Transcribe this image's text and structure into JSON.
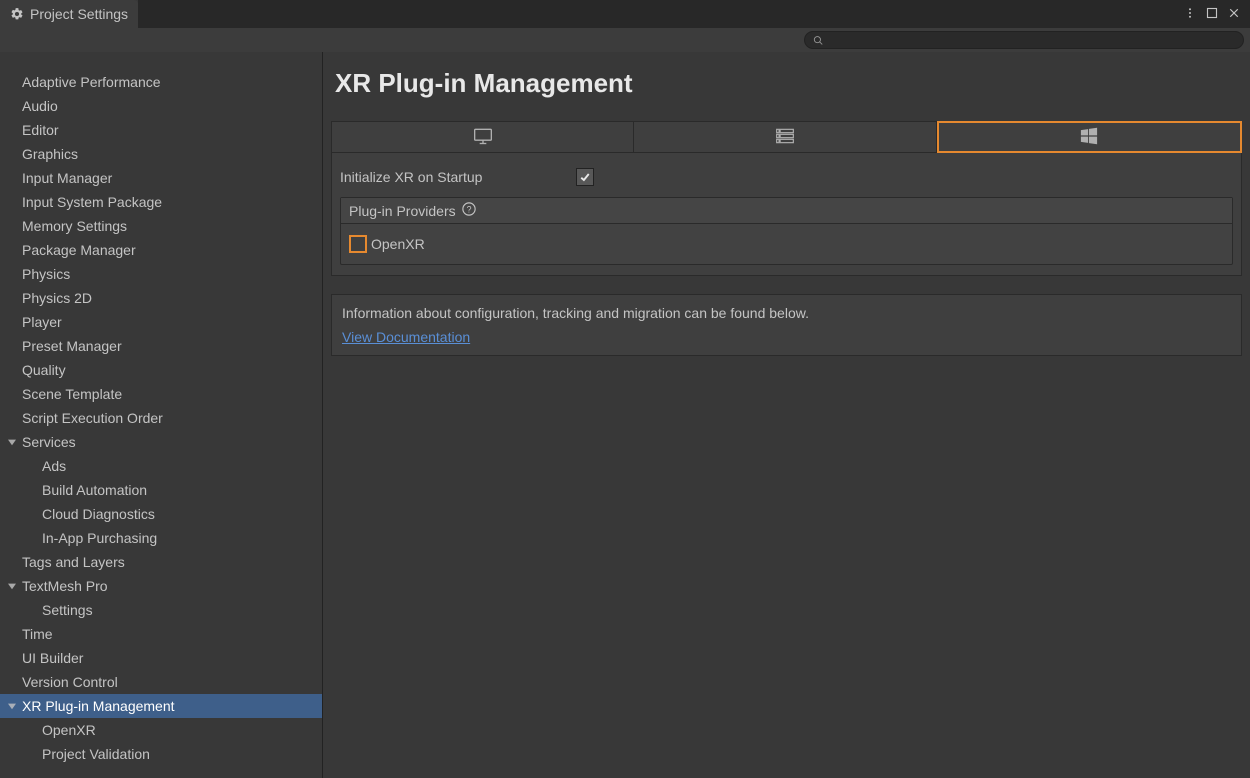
{
  "window": {
    "title": "Project Settings"
  },
  "search": {
    "placeholder": ""
  },
  "sidebar": {
    "items": [
      {
        "label": "Adaptive Performance",
        "sub": false
      },
      {
        "label": "Audio",
        "sub": false
      },
      {
        "label": "Editor",
        "sub": false
      },
      {
        "label": "Graphics",
        "sub": false
      },
      {
        "label": "Input Manager",
        "sub": false
      },
      {
        "label": "Input System Package",
        "sub": false
      },
      {
        "label": "Memory Settings",
        "sub": false
      },
      {
        "label": "Package Manager",
        "sub": false
      },
      {
        "label": "Physics",
        "sub": false
      },
      {
        "label": "Physics 2D",
        "sub": false
      },
      {
        "label": "Player",
        "sub": false
      },
      {
        "label": "Preset Manager",
        "sub": false
      },
      {
        "label": "Quality",
        "sub": false
      },
      {
        "label": "Scene Template",
        "sub": false
      },
      {
        "label": "Script Execution Order",
        "sub": false
      },
      {
        "label": "Services",
        "sub": false,
        "fold": true
      },
      {
        "label": "Ads",
        "sub": true
      },
      {
        "label": "Build Automation",
        "sub": true
      },
      {
        "label": "Cloud Diagnostics",
        "sub": true
      },
      {
        "label": "In-App Purchasing",
        "sub": true
      },
      {
        "label": "Tags and Layers",
        "sub": false
      },
      {
        "label": "TextMesh Pro",
        "sub": false,
        "fold": true
      },
      {
        "label": "Settings",
        "sub": true
      },
      {
        "label": "Time",
        "sub": false
      },
      {
        "label": "UI Builder",
        "sub": false
      },
      {
        "label": "Version Control",
        "sub": false
      },
      {
        "label": "XR Plug-in Management",
        "sub": false,
        "fold": true,
        "selected": true
      },
      {
        "label": "OpenXR",
        "sub": true
      },
      {
        "label": "Project Validation",
        "sub": true
      }
    ]
  },
  "main": {
    "title": "XR Plug-in Management",
    "initialize_label": "Initialize XR on Startup",
    "initialize_checked": true,
    "providers_header": "Plug-in Providers",
    "providers": [
      {
        "label": "OpenXR",
        "checked": false,
        "highlighted": true
      }
    ],
    "info_text": "Information about configuration, tracking and migration can be found below.",
    "link_text": "View Documentation",
    "tabs": [
      {
        "icon": "monitor",
        "highlighted": false
      },
      {
        "icon": "server",
        "highlighted": false
      },
      {
        "icon": "windows",
        "highlighted": true
      }
    ]
  }
}
